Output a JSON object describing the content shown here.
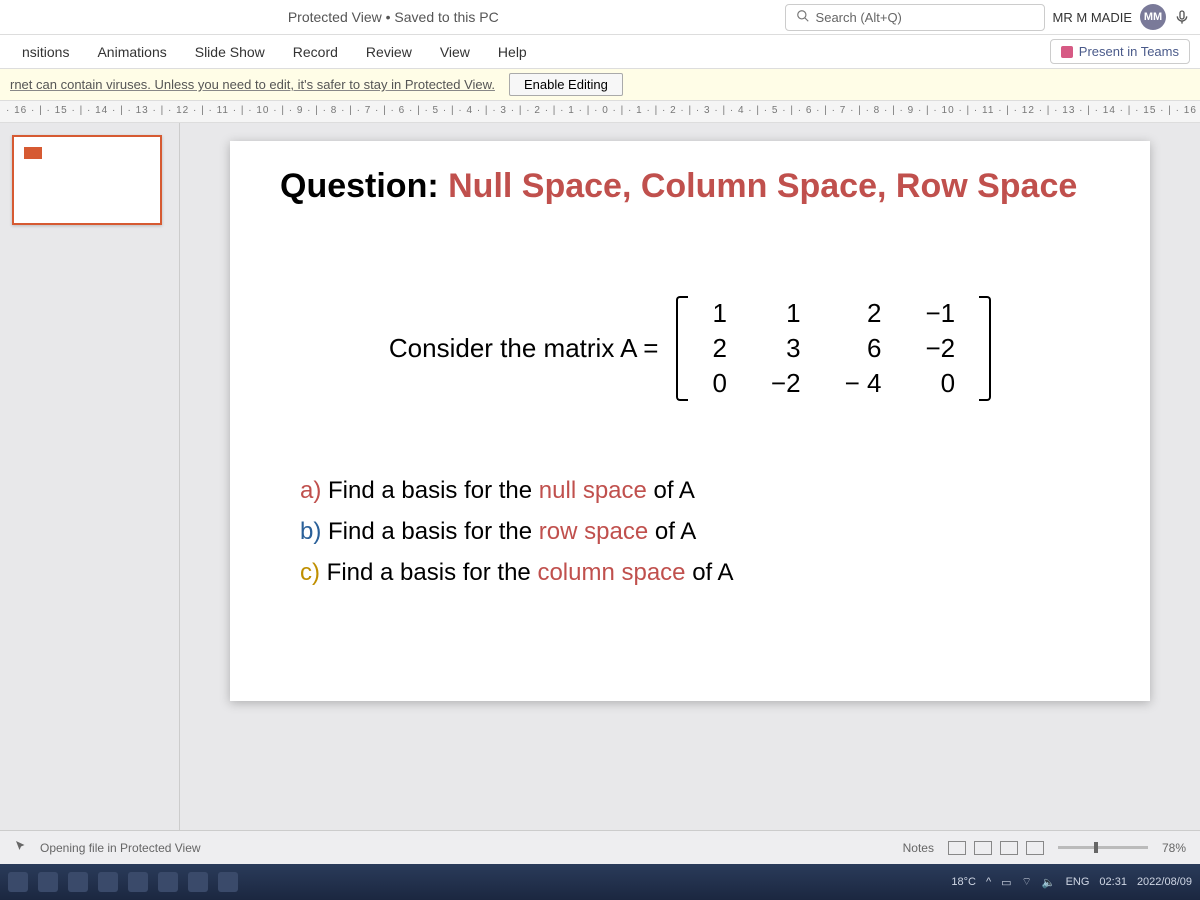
{
  "titlebar": {
    "doc_state": "Protected View • Saved to this PC",
    "search_placeholder": "Search (Alt+Q)",
    "user_name": "MR M MADIE",
    "user_initials": "MM"
  },
  "ribbon": {
    "tabs": [
      "nsitions",
      "Animations",
      "Slide Show",
      "Record",
      "Review",
      "View",
      "Help"
    ],
    "present_label": "Present in Teams"
  },
  "protected": {
    "message": "rnet can contain viruses. Unless you need to edit, it's safer to stay in Protected View.",
    "enable_label": "Enable Editing"
  },
  "ruler": {
    "text": "· 16 · | · 15 · | · 14 · | · 13 · | · 12 · | · 11 · | · 10 · | · 9 · | · 8 · | · 7 · | · 6 · | · 5 · | · 4 · | · 3 · | · 2 · | · 1 · | · 0 · | · 1 · | · 2 · | · 3 · | · 4 · | · 5 · | · 6 · | · 7 · | · 8 · | · 9 · | · 10 · | · 11 · | · 12 · | · 13 · | · 14 · | · 15 · | · 16"
  },
  "slide": {
    "title_label": "Question:",
    "title_topic": " Null Space, Column Space, Row Space",
    "matrix_intro": "Consider the matrix  A  =",
    "matrix": [
      [
        "1",
        "1",
        "2",
        "−1"
      ],
      [
        "2",
        "3",
        "6",
        "−2"
      ],
      [
        "0",
        "−2",
        "− 4",
        "0"
      ]
    ],
    "tasks": {
      "a_label": "a)",
      "a_pre": "  Find a basis for the ",
      "a_hl": "null space",
      "a_post": " of A",
      "b_label": "b)",
      "b_pre": "  Find a basis for the ",
      "b_hl": "row space",
      "b_post": " of A",
      "c_label": "c)",
      "c_pre": "  Find a basis for the ",
      "c_hl": "column space",
      "c_post": " of A"
    }
  },
  "ppt_status": {
    "opening": "Opening file in Protected View",
    "notes": "Notes",
    "zoom": "78%"
  },
  "taskbar": {
    "temp": "18°C",
    "lang": "ENG",
    "time": "02:31",
    "date": "2022/08/09"
  }
}
